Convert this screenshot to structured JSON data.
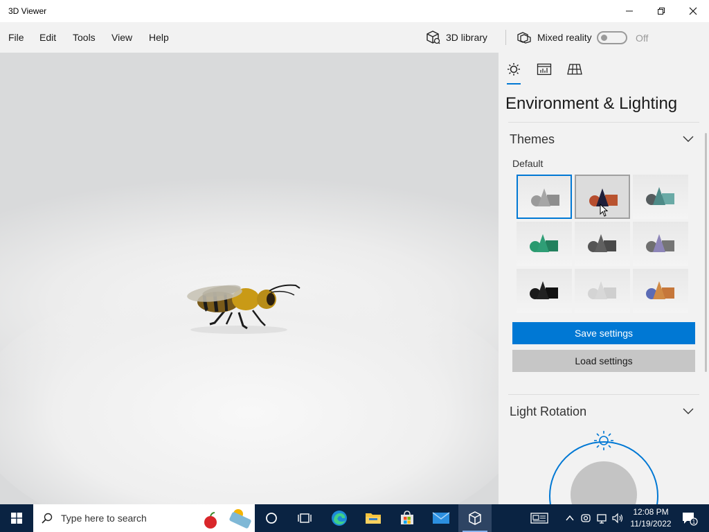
{
  "window": {
    "title": "3D Viewer"
  },
  "menu": {
    "file": "File",
    "edit": "Edit",
    "tools": "Tools",
    "view": "View",
    "help": "Help",
    "library_label": "3D library",
    "mixed_reality_label": "Mixed reality",
    "mixed_reality_state": "Off"
  },
  "panel": {
    "title": "Environment & Lighting",
    "tabs": [
      "lighting-tab",
      "stats-tab",
      "grid-tab"
    ],
    "themes": {
      "title": "Themes",
      "selected_label": "Default",
      "items": [
        {
          "name": "default",
          "shape": "#9a9a9a",
          "cone": "#a6a6a6",
          "box": "#8e8e8e"
        },
        {
          "name": "warm",
          "shape": "#b64d2e",
          "cone": "#1f1f3a",
          "box": "#b9532f"
        },
        {
          "name": "teal-grey",
          "shape": "#555c5e",
          "cone": "#4d8a87",
          "box": "#6aaaa6"
        },
        {
          "name": "green",
          "shape": "#2a9a6f",
          "cone": "#2f9e76",
          "box": "#22805d"
        },
        {
          "name": "dark-grey",
          "shape": "#555555",
          "cone": "#606060",
          "box": "#4a4a4a"
        },
        {
          "name": "purple",
          "shape": "#6f6f6f",
          "cone": "#8d85b8",
          "box": "#757575"
        },
        {
          "name": "black",
          "shape": "#1a1a1a",
          "cone": "#222222",
          "box": "#111111"
        },
        {
          "name": "ghost",
          "shape": "#d4d4d4",
          "cone": "#d8d8d8",
          "box": "#cfcfcf"
        },
        {
          "name": "multicolor",
          "shape": "#5b6bb5",
          "cone": "#d08a45",
          "box": "#c6773a"
        }
      ],
      "save_label": "Save settings",
      "load_label": "Load settings"
    },
    "light_rotation": {
      "title": "Light Rotation"
    }
  },
  "taskbar": {
    "search_placeholder": "Type here to search",
    "time": "12:08 PM",
    "date": "11/19/2022",
    "notification_count": "1"
  },
  "colors": {
    "accent": "#0078d4",
    "taskbar": "#0a2342"
  }
}
